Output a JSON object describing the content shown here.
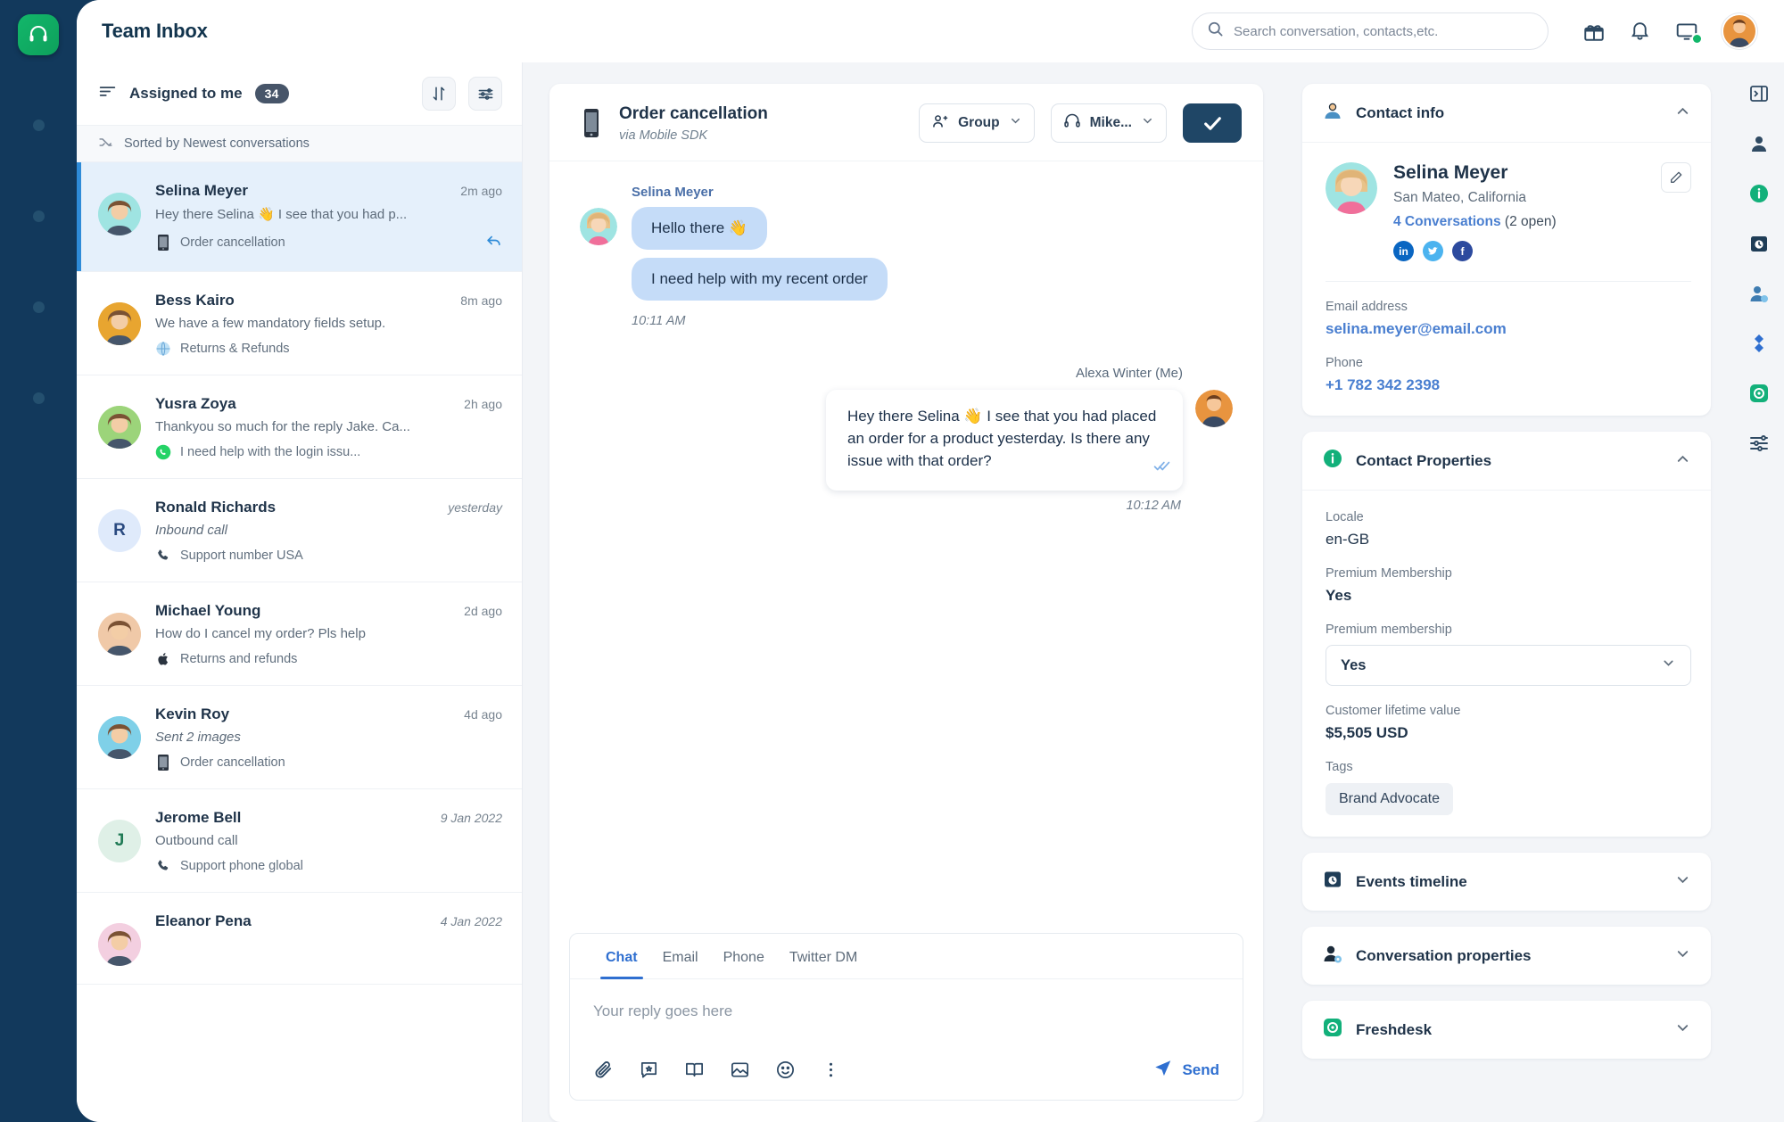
{
  "topbar": {
    "title": "Team Inbox",
    "search_placeholder": "Search conversation, contacts,etc.",
    "icons": [
      "gift-icon",
      "bell-icon",
      "screen-share-icon",
      "avatar"
    ]
  },
  "list": {
    "header_title": "Assigned to me",
    "count": "34",
    "sort_label": "Sorted by Newest conversations",
    "sort_button": "sort-icon",
    "filter_button": "filter-icon",
    "conversations": [
      {
        "name": "Selina Meyer",
        "time": "2m ago",
        "snippet": "Hey there Selina 👋 I see that you had p...",
        "channel": "Order cancellation",
        "channel_icon": "mobile-sdk-icon",
        "avatar_color": "#9fe4e2",
        "initial": "",
        "italic": false,
        "active": true,
        "has_reply_arrow": true
      },
      {
        "name": "Bess Kairo",
        "time": "8m ago",
        "snippet": "We have a few mandatory fields setup.",
        "channel": "Returns & Refunds",
        "channel_icon": "globe-icon",
        "avatar_color": "#e8a530",
        "initial": "",
        "italic": false,
        "active": false,
        "has_reply_arrow": false
      },
      {
        "name": "Yusra Zoya",
        "time": "2h ago",
        "snippet": "Thankyou so much for the reply Jake. Ca...",
        "channel": "I need help with the login issu...",
        "channel_icon": "whatsapp-icon",
        "avatar_color": "#9cd47a",
        "initial": "",
        "italic": false,
        "active": false,
        "has_reply_arrow": false
      },
      {
        "name": "Ronald Richards",
        "time": "yesterday",
        "snippet": "Inbound call",
        "channel": "Support number USA",
        "channel_icon": "phone-icon",
        "avatar_color": "#dfeafb",
        "initial": "R",
        "initial_color": "#2a4a80",
        "italic": true,
        "active": false,
        "has_reply_arrow": false
      },
      {
        "name": "Michael Young",
        "time": "2d ago",
        "snippet": "How do I cancel my order? Pls help",
        "channel": "Returns and refunds",
        "channel_icon": "apple-icon",
        "avatar_color": "#f0c9a8",
        "initial": "",
        "italic": false,
        "active": false,
        "has_reply_arrow": false
      },
      {
        "name": "Kevin Roy",
        "time": "4d ago",
        "snippet": "Sent 2 images",
        "channel": "Order cancellation",
        "channel_icon": "mobile-sdk-icon",
        "avatar_color": "#7fd0e8",
        "initial": "",
        "italic": true,
        "active": false,
        "has_reply_arrow": false
      },
      {
        "name": "Jerome Bell",
        "time": "9 Jan 2022",
        "snippet": "Outbound call",
        "channel": "Support phone global",
        "channel_icon": "phone-icon",
        "avatar_color": "#dff0e7",
        "initial": "J",
        "initial_color": "#1f7a55",
        "italic": false,
        "active": false,
        "has_reply_arrow": false
      },
      {
        "name": "Eleanor Pena",
        "time": "4 Jan 2022",
        "snippet": "",
        "channel": "",
        "channel_icon": "",
        "avatar_color": "#f3cfe0",
        "initial": "",
        "italic": false,
        "active": false,
        "has_reply_arrow": false
      }
    ]
  },
  "chat": {
    "title": "Order cancellation",
    "subtitle": "via Mobile SDK",
    "group_button": "Group",
    "agent_button": "Mike...",
    "resolve_button": "check-icon",
    "messages": [
      {
        "direction": "in",
        "sender": "Selina Meyer",
        "bubbles": [
          "Hello there 👋",
          "I need help with my recent order"
        ],
        "time": "10:11 AM"
      },
      {
        "direction": "out",
        "sender": "Alexa Winter (Me)",
        "bubbles": [
          "Hey there Selina 👋 I see that you had placed an order for a product yesterday. Is there any issue with that order?"
        ],
        "time": "10:12 AM"
      }
    ],
    "composer": {
      "tabs": [
        "Chat",
        "Email",
        "Phone",
        "Twitter DM"
      ],
      "active_tab": "Chat",
      "placeholder": "Your reply goes here",
      "tools": [
        "attachment-icon",
        "canned-response-icon",
        "knowledge-base-icon",
        "image-icon",
        "emoji-icon",
        "more-icon"
      ],
      "send_label": "Send"
    }
  },
  "info": {
    "contact_info": {
      "title": "Contact info",
      "name": "Selina Meyer",
      "location": "San Mateo, California",
      "conversations_link": "4 Conversations",
      "conversations_open": "(2 open)",
      "socials": [
        "linkedin-icon",
        "twitter-icon",
        "facebook-icon"
      ],
      "email_label": "Email address",
      "email_value": "selina.meyer@email.com",
      "phone_label": "Phone",
      "phone_value": "+1 782 342 2398"
    },
    "contact_properties": {
      "title": "Contact Properties",
      "fields": [
        {
          "label": "Locale",
          "value": "en-GB",
          "type": "text"
        },
        {
          "label": "Premium Membership",
          "value": "Yes",
          "type": "bold"
        },
        {
          "label": "Premium membership",
          "value": "Yes",
          "type": "select"
        },
        {
          "label": "Customer lifetime value",
          "value": "$5,505 USD",
          "type": "bold"
        }
      ],
      "tags_label": "Tags",
      "tags": [
        "Brand Advocate"
      ]
    },
    "sections": [
      {
        "title": "Events timeline",
        "icon": "clock-calendar-icon"
      },
      {
        "title": "Conversation properties",
        "icon": "user-gear-icon"
      },
      {
        "title": "Freshdesk",
        "icon": "freshdesk-icon"
      }
    ]
  },
  "iconrail": {
    "items": [
      "panel-collapse-icon",
      "contact-icon",
      "info-icon",
      "timeline-icon",
      "user-properties-icon",
      "apps-icon",
      "freshdesk-icon",
      "settings-icon"
    ]
  },
  "colors": {
    "accent": "#2f6fd0",
    "dark": "#1f4666",
    "green": "#12b76a",
    "sidebar": "#12395c",
    "active_row": "#e5f0fb"
  }
}
